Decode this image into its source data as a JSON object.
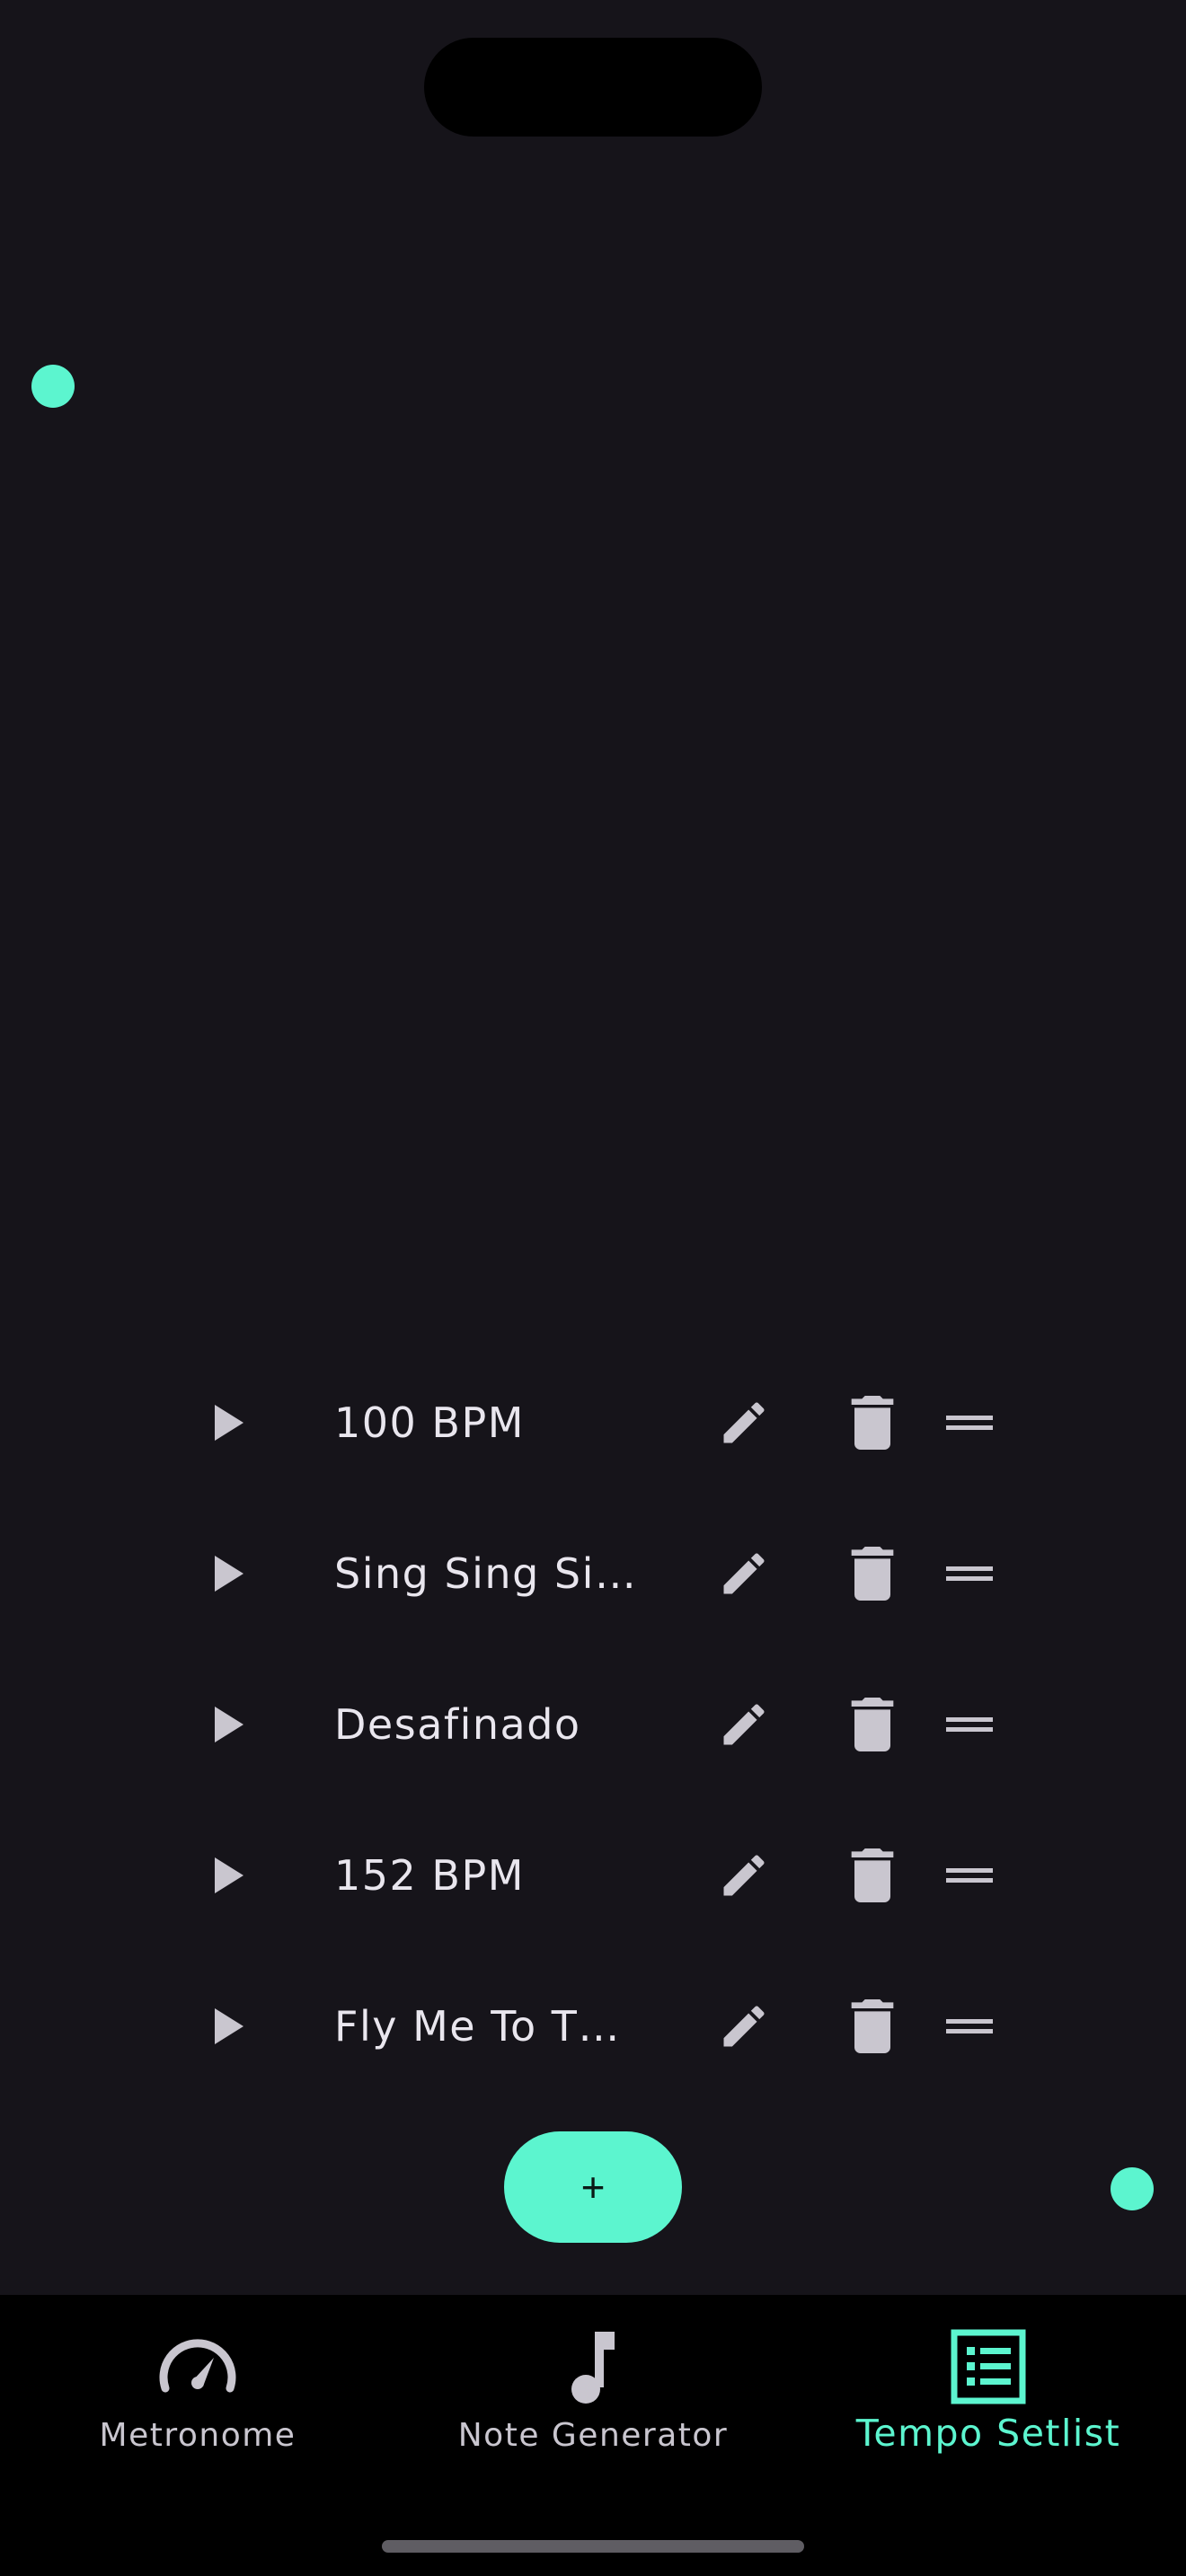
{
  "colors": {
    "background": "#16141a",
    "accent": "#5cf5cf",
    "icon": "#c9c6cf",
    "text": "#e9e6ee",
    "nav_background": "#000000"
  },
  "setlist": {
    "items": [
      {
        "title": "100 BPM"
      },
      {
        "title": "Sing Sing Si…"
      },
      {
        "title": "Desafinado"
      },
      {
        "title": "152 BPM"
      },
      {
        "title": "Fly Me To T…"
      }
    ],
    "item_icons": {
      "play": "play-icon",
      "edit": "pencil-icon",
      "delete": "trash-icon",
      "reorder": "drag-handle-icon"
    },
    "add_button_label": "+"
  },
  "bottom_nav": {
    "items": [
      {
        "label": "Metronome",
        "icon": "speedometer-icon",
        "active": false
      },
      {
        "label": "Note Generator",
        "icon": "music-note-icon",
        "active": false
      },
      {
        "label": "Tempo Setlist",
        "icon": "list-icon",
        "active": true
      }
    ]
  }
}
